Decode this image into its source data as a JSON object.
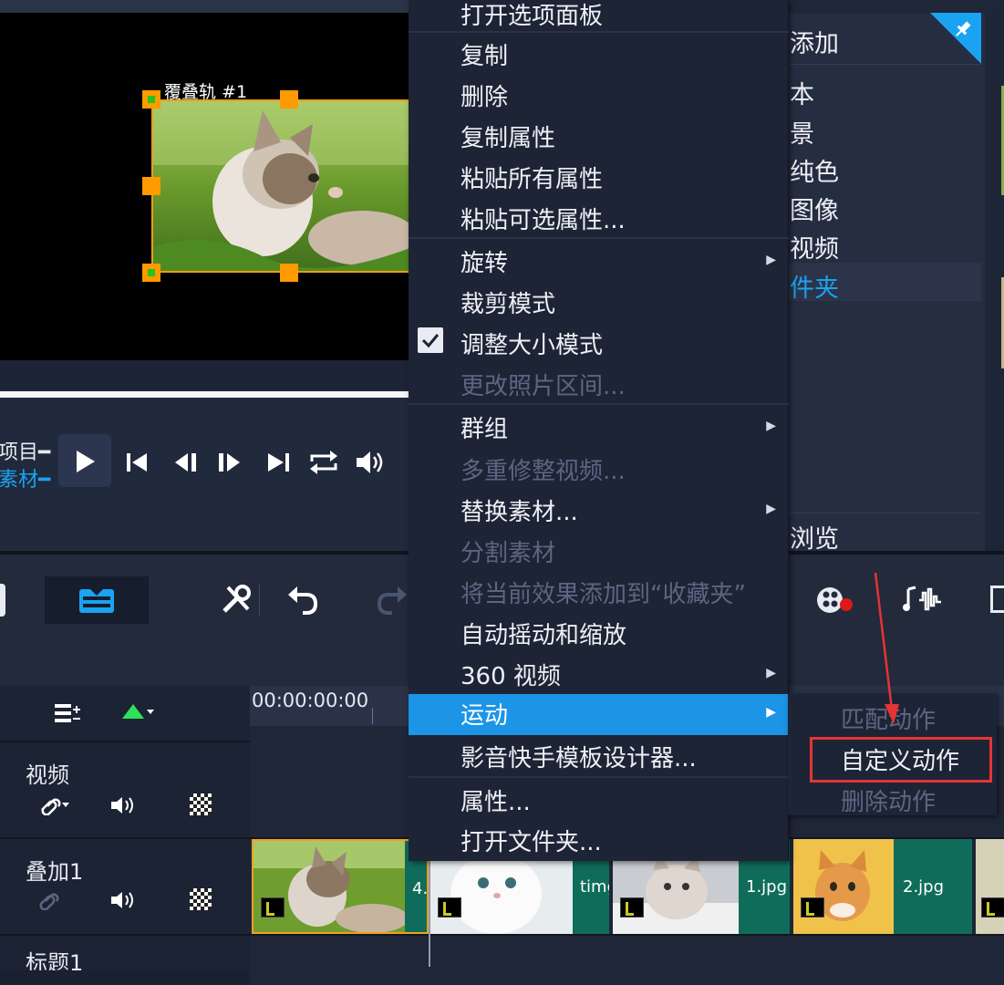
{
  "preview": {
    "overlay_label": "覆叠轨 #1"
  },
  "transport": {
    "project_label": "项目",
    "clip_label": "素材"
  },
  "library": {
    "items": [
      "添加",
      "本",
      "景",
      "纯色",
      "图像",
      "视频",
      "件夹"
    ],
    "browse_label": "浏览",
    "selected_index": 6
  },
  "context_menu": {
    "items": [
      {
        "label": "打开选项面板",
        "enabled": true
      },
      {
        "label": "复制",
        "enabled": true
      },
      {
        "label": "删除",
        "enabled": true
      },
      {
        "label": "复制属性",
        "enabled": true
      },
      {
        "label": "粘贴所有属性",
        "enabled": true
      },
      {
        "label": "粘贴可选属性...",
        "enabled": true
      },
      {
        "label": "旋转",
        "enabled": true,
        "submenu": true
      },
      {
        "label": "裁剪模式",
        "enabled": true
      },
      {
        "label": "调整大小模式",
        "enabled": true,
        "checked": true
      },
      {
        "label": "更改照片区间...",
        "enabled": false
      },
      {
        "label": "群组",
        "enabled": true,
        "submenu": true
      },
      {
        "label": "多重修整视频...",
        "enabled": false
      },
      {
        "label": "替换素材...",
        "enabled": true,
        "submenu": true
      },
      {
        "label": "分割素材",
        "enabled": false
      },
      {
        "label": "将当前效果添加到“收藏夹”",
        "enabled": false
      },
      {
        "label": "自动摇动和缩放",
        "enabled": true
      },
      {
        "label": "360 视频",
        "enabled": true,
        "submenu": true
      },
      {
        "label": "运动",
        "enabled": true,
        "submenu": true,
        "selected": true
      },
      {
        "label": "影音快手模板设计器...",
        "enabled": true
      },
      {
        "label": "属性...",
        "enabled": true
      },
      {
        "label": "打开文件夹...",
        "enabled": true
      }
    ]
  },
  "submenu": {
    "items": [
      {
        "label": "匹配动作",
        "enabled": false
      },
      {
        "label": "自定义动作",
        "enabled": true,
        "highlighted": true
      },
      {
        "label": "删除动作",
        "enabled": false
      }
    ]
  },
  "timeline": {
    "timecode": "00:00:00:00",
    "tracks": [
      "视频",
      "叠加1",
      "标题1"
    ],
    "clips": [
      {
        "name": "4.",
        "thumb": "kitten-grass"
      },
      {
        "name": "timg",
        "thumb": "white-cat"
      },
      {
        "name": "1.jpg",
        "thumb": "grey-kitten"
      },
      {
        "name": "2.jpg",
        "thumb": "orange-kitten"
      }
    ]
  },
  "colors": {
    "menu_bg": "#1d2436",
    "menu_selected": "#1c95e6",
    "highlight_box": "#e53434",
    "handle": "#ff9a00",
    "clip_bg": "#0f6c5a",
    "accent_blue": "#1aa3f2"
  },
  "icons": [
    "play-icon",
    "skip-start-icon",
    "prev-frame-icon",
    "next-frame-icon",
    "skip-end-icon",
    "repeat-icon",
    "volume-icon",
    "storyboard-icon",
    "tools-icon",
    "undo-icon",
    "redo-icon",
    "film-record-icon",
    "audio-fx-icon",
    "pin-icon",
    "track-manager-icon",
    "add-marker-icon",
    "link-icon",
    "mute-icon",
    "checker-icon",
    "checkmark-icon",
    "submenu-arrow-icon",
    "clip-type-icon"
  ]
}
